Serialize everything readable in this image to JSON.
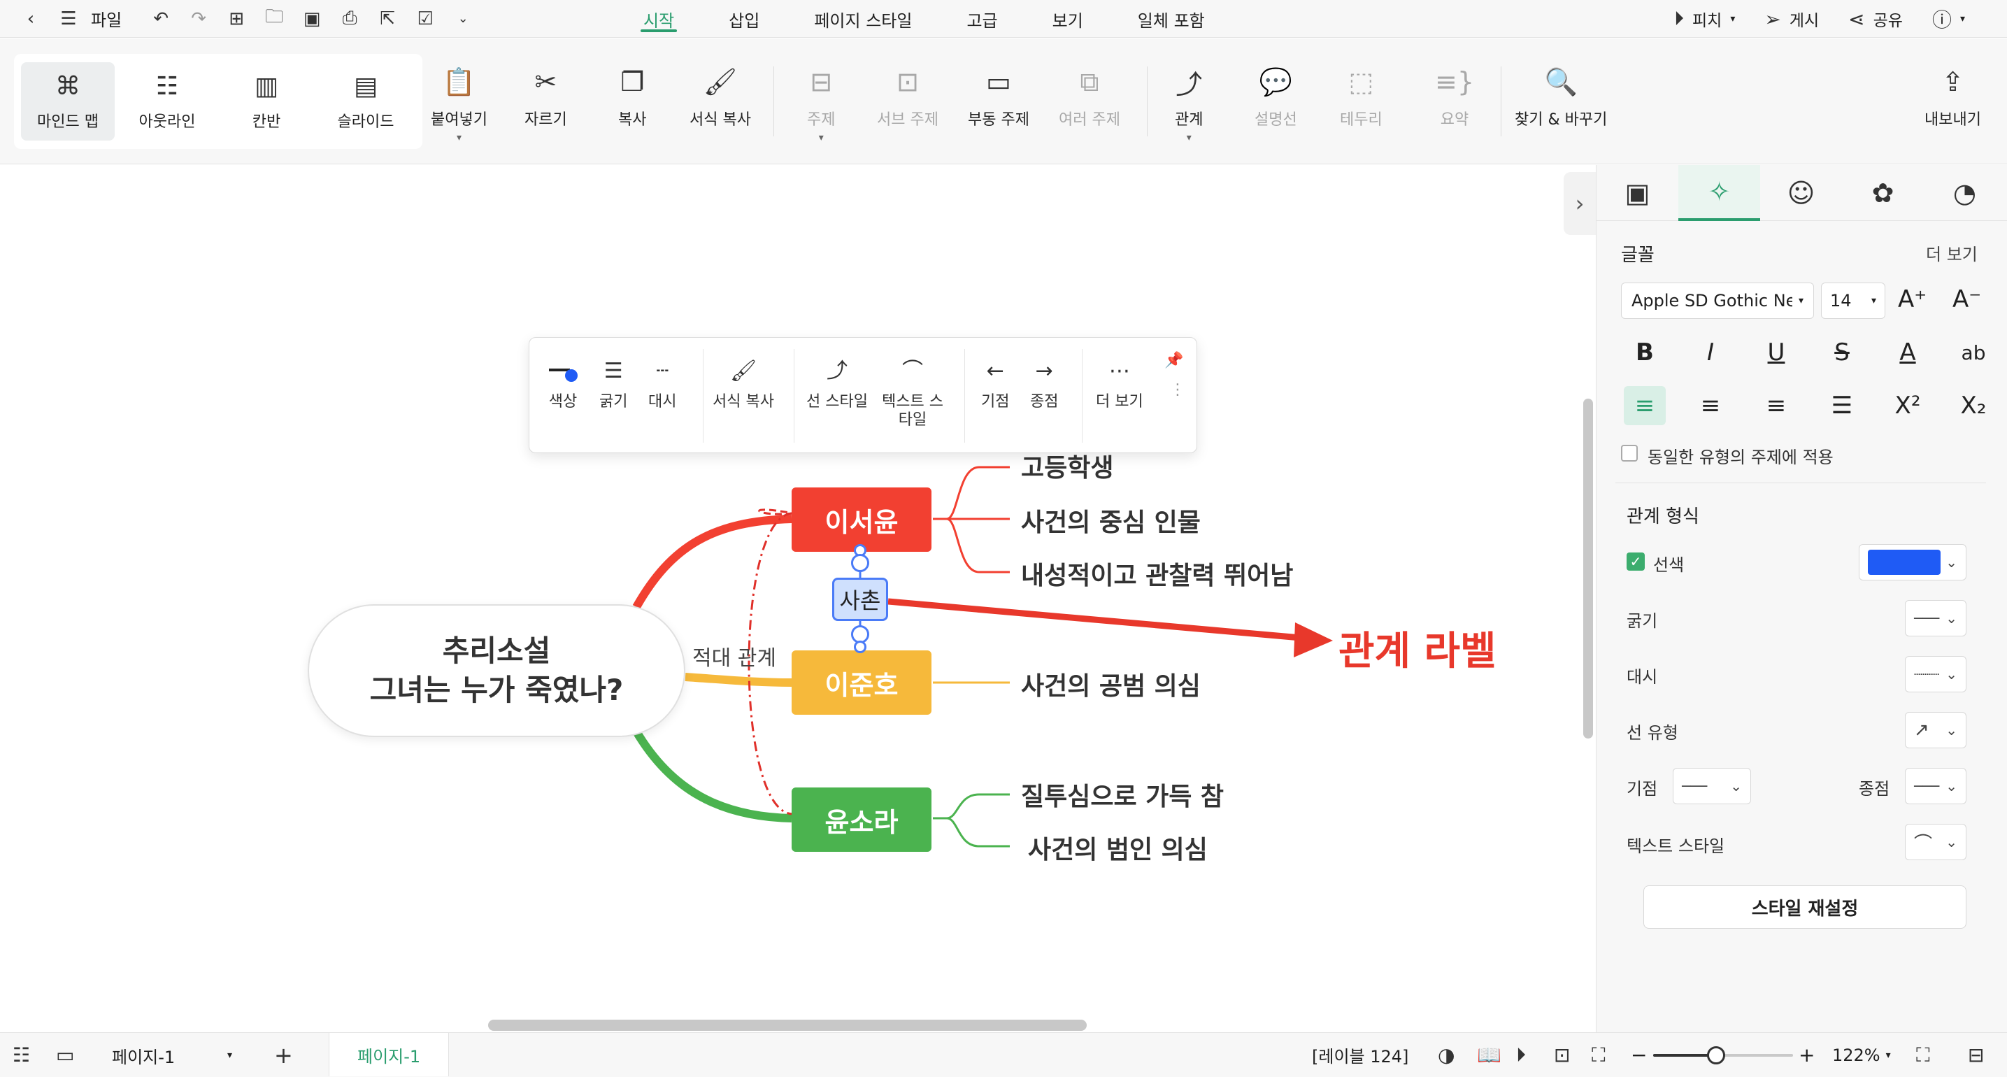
{
  "menubar": {
    "file_label": "파일",
    "tabs": [
      "시작",
      "삽입",
      "페이지 스타일",
      "고급",
      "보기",
      "일체 포함"
    ],
    "pitch_label": "피치",
    "publish_label": "게시",
    "share_label": "공유"
  },
  "ribbon": {
    "views": [
      "마인드 맵",
      "아웃라인",
      "칸반",
      "슬라이드"
    ],
    "paste": "붙여넣기",
    "cut": "자르기",
    "copy": "복사",
    "format_painter": "서식 복사",
    "topic": "주제",
    "subtopic": "서브 주제",
    "floating_topic": "부동 주제",
    "multiple_topics": "여러 주제",
    "relationship": "관계",
    "callout": "설명선",
    "boundary": "테두리",
    "summary": "요약",
    "find_replace": "찾기 & 바꾸기",
    "export": "내보내기"
  },
  "float_toolbar": {
    "color": "색상",
    "thickness": "굵기",
    "dash": "대시",
    "format_painter": "서식 복사",
    "line_style": "선 스타일",
    "text_style_1": "텍스트 스",
    "text_style_2": "타일",
    "start": "기점",
    "end": "종점",
    "more": "더 보기"
  },
  "mindmap": {
    "central_line1": "추리소설",
    "central_line2": "그녀는 누가 죽였나?",
    "topics": [
      {
        "label": "이서윤",
        "color": "#f24031",
        "subs": [
          "고등학생",
          "사건의 중심 인물",
          "내성적이고 관찰력 뛰어남"
        ]
      },
      {
        "label": "이준호",
        "color": "#f6b93b",
        "subs": [
          "사건의 공범 의심"
        ]
      },
      {
        "label": "윤소라",
        "color": "#4bb34f",
        "subs": [
          "질투심으로 가득 참",
          "사건의 범인 의심"
        ]
      }
    ],
    "relation_label": "사촌",
    "adversarial_label": "적대 관계",
    "callout_label": "관계 라벨"
  },
  "panel": {
    "font_heading": "글꼴",
    "more": "더 보기",
    "font_family": "Apple SD Gothic Neo",
    "font_size": "14",
    "apply_same_type": "동일한 유형의 주제에 적용",
    "relationship_heading": "관계 형식",
    "line_color_label": "선색",
    "line_color": "#1f5bf5",
    "thickness_label": "굵기",
    "dash_label": "대시",
    "line_type_label": "선 유형",
    "start_label": "기점",
    "end_label": "종점",
    "text_style_label": "텍스트 스타일",
    "reset_button": "스타일 재설정"
  },
  "statusbar": {
    "page_select": "페이지-1",
    "page_tab": "페이지-1",
    "label_count": "[레이블 124]",
    "zoom": "122%",
    "zoom_level": 0.45
  }
}
